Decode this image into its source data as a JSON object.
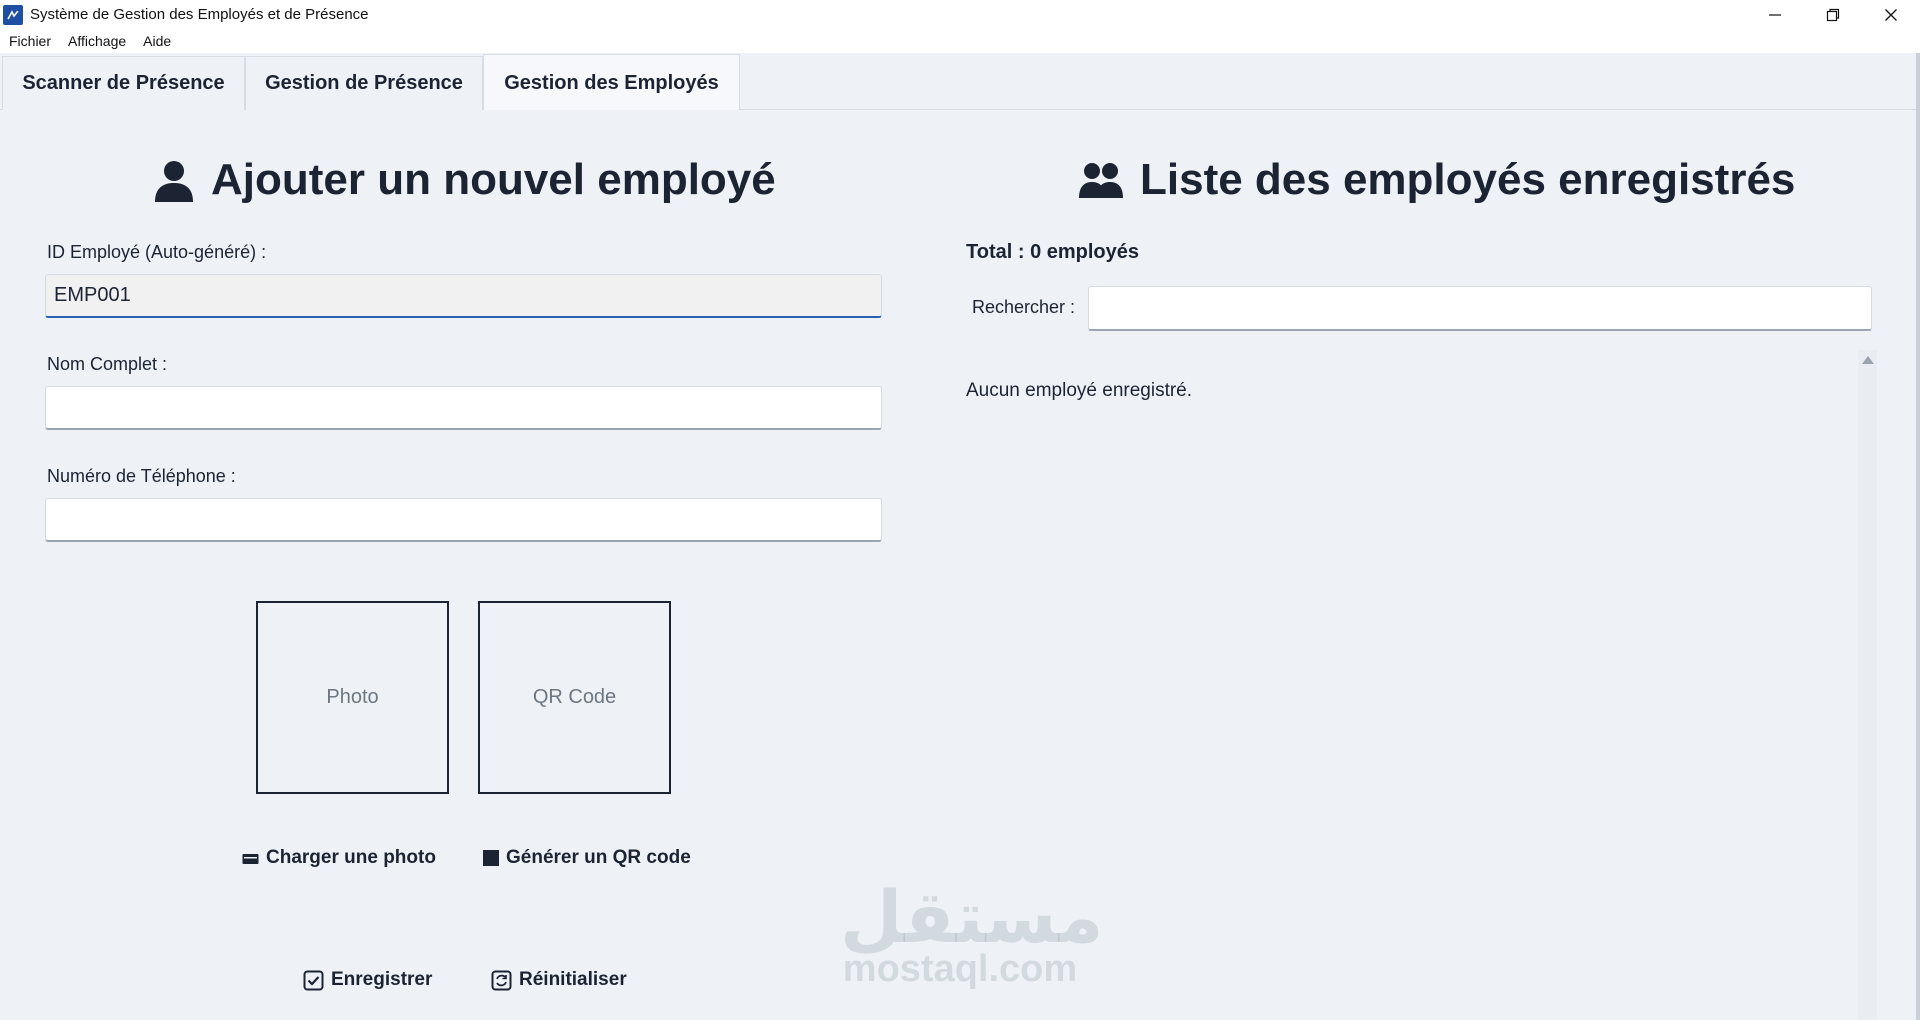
{
  "window": {
    "title": "Système de Gestion des Employés et de Présence"
  },
  "menu": {
    "items": [
      "Fichier",
      "Affichage",
      "Aide"
    ]
  },
  "tabs": [
    {
      "label": "Scanner de Présence",
      "active": false
    },
    {
      "label": "Gestion de Présence",
      "active": false
    },
    {
      "label": "Gestion des Employés",
      "active": true
    }
  ],
  "add_form": {
    "title": "Ajouter un nouvel employé",
    "id_label": "ID Employé (Auto-généré) :",
    "id_value": "EMP001",
    "name_label": "Nom Complet :",
    "name_value": "",
    "phone_label": "Numéro de Téléphone :",
    "phone_value": "",
    "photo_placeholder": "Photo",
    "qr_placeholder": "QR Code",
    "upload_photo_label": "Charger une photo",
    "generate_qr_label": "Générer un QR code",
    "save_label": "Enregistrer",
    "reset_label": "Réinitialiser"
  },
  "employee_list": {
    "title": "Liste des employés enregistrés",
    "total_text": "Total : 0 employés",
    "search_label": "Rechercher :",
    "search_value": "",
    "empty_message": "Aucun employé enregistré."
  },
  "watermark": {
    "arabic": "مستقل",
    "latin": "mostaql.com"
  },
  "colors": {
    "accent": "#2a5fb4",
    "text": "#1c2433",
    "background": "#eef2f6"
  }
}
